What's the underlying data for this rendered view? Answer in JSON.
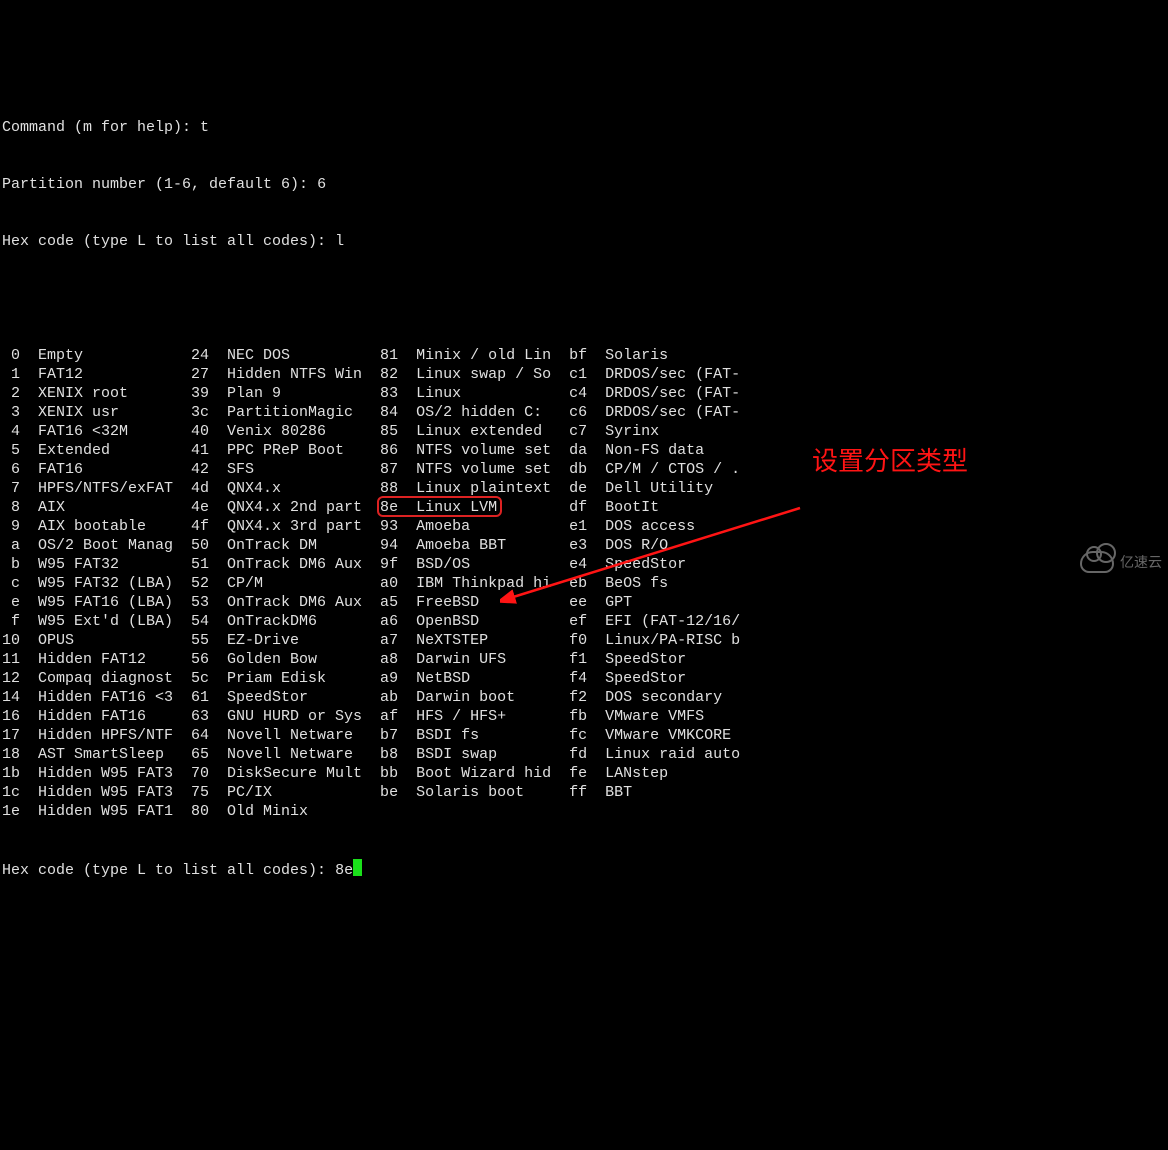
{
  "prompts": {
    "command": "Command (m for help): ",
    "command_input": "t",
    "partition": "Partition number (1-6, default 6): ",
    "partition_input": "6",
    "hexcode1": "Hex code (type L to list all codes): ",
    "hexcode1_input": "l",
    "hexcode2": "Hex code (type L to list all codes): ",
    "hexcode2_input": "8e"
  },
  "table_rows": [
    [
      " 0",
      "Empty",
      "24",
      "NEC DOS",
      "81",
      "Minix / old Lin",
      "bf",
      "Solaris"
    ],
    [
      " 1",
      "FAT12",
      "27",
      "Hidden NTFS Win",
      "82",
      "Linux swap / So",
      "c1",
      "DRDOS/sec (FAT-"
    ],
    [
      " 2",
      "XENIX root",
      "39",
      "Plan 9",
      "83",
      "Linux",
      "c4",
      "DRDOS/sec (FAT-"
    ],
    [
      " 3",
      "XENIX usr",
      "3c",
      "PartitionMagic",
      "84",
      "OS/2 hidden C:",
      "c6",
      "DRDOS/sec (FAT-"
    ],
    [
      " 4",
      "FAT16 <32M",
      "40",
      "Venix 80286",
      "85",
      "Linux extended",
      "c7",
      "Syrinx"
    ],
    [
      " 5",
      "Extended",
      "41",
      "PPC PReP Boot",
      "86",
      "NTFS volume set",
      "da",
      "Non-FS data"
    ],
    [
      " 6",
      "FAT16",
      "42",
      "SFS",
      "87",
      "NTFS volume set",
      "db",
      "CP/M / CTOS / ."
    ],
    [
      " 7",
      "HPFS/NTFS/exFAT",
      "4d",
      "QNX4.x",
      "88",
      "Linux plaintext",
      "de",
      "Dell Utility"
    ],
    [
      " 8",
      "AIX",
      "4e",
      "QNX4.x 2nd part",
      "8e",
      "Linux LVM",
      "df",
      "BootIt"
    ],
    [
      " 9",
      "AIX bootable",
      "4f",
      "QNX4.x 3rd part",
      "93",
      "Amoeba",
      "e1",
      "DOS access"
    ],
    [
      " a",
      "OS/2 Boot Manag",
      "50",
      "OnTrack DM",
      "94",
      "Amoeba BBT",
      "e3",
      "DOS R/O"
    ],
    [
      " b",
      "W95 FAT32",
      "51",
      "OnTrack DM6 Aux",
      "9f",
      "BSD/OS",
      "e4",
      "SpeedStor"
    ],
    [
      " c",
      "W95 FAT32 (LBA)",
      "52",
      "CP/M",
      "a0",
      "IBM Thinkpad hi",
      "eb",
      "BeOS fs"
    ],
    [
      " e",
      "W95 FAT16 (LBA)",
      "53",
      "OnTrack DM6 Aux",
      "a5",
      "FreeBSD",
      "ee",
      "GPT"
    ],
    [
      " f",
      "W95 Ext'd (LBA)",
      "54",
      "OnTrackDM6",
      "a6",
      "OpenBSD",
      "ef",
      "EFI (FAT-12/16/"
    ],
    [
      "10",
      "OPUS",
      "55",
      "EZ-Drive",
      "a7",
      "NeXTSTEP",
      "f0",
      "Linux/PA-RISC b"
    ],
    [
      "11",
      "Hidden FAT12",
      "56",
      "Golden Bow",
      "a8",
      "Darwin UFS",
      "f1",
      "SpeedStor"
    ],
    [
      "12",
      "Compaq diagnost",
      "5c",
      "Priam Edisk",
      "a9",
      "NetBSD",
      "f4",
      "SpeedStor"
    ],
    [
      "14",
      "Hidden FAT16 <3",
      "61",
      "SpeedStor",
      "ab",
      "Darwin boot",
      "f2",
      "DOS secondary"
    ],
    [
      "16",
      "Hidden FAT16",
      "63",
      "GNU HURD or Sys",
      "af",
      "HFS / HFS+",
      "fb",
      "VMware VMFS"
    ],
    [
      "17",
      "Hidden HPFS/NTF",
      "64",
      "Novell Netware",
      "b7",
      "BSDI fs",
      "fc",
      "VMware VMKCORE"
    ],
    [
      "18",
      "AST SmartSleep",
      "65",
      "Novell Netware",
      "b8",
      "BSDI swap",
      "fd",
      "Linux raid auto"
    ],
    [
      "1b",
      "Hidden W95 FAT3",
      "70",
      "DiskSecure Mult",
      "bb",
      "Boot Wizard hid",
      "fe",
      "LANstep"
    ],
    [
      "1c",
      "Hidden W95 FAT3",
      "75",
      "PC/IX",
      "be",
      "Solaris boot",
      "ff",
      "BBT"
    ],
    [
      "1e",
      "Hidden W95 FAT1",
      "80",
      "Old Minix",
      "",
      "",
      "",
      ""
    ]
  ],
  "highlight": {
    "row_index": 8,
    "col_start": 4,
    "label": "Linux LVM"
  },
  "annotation_text": "设置分区类型",
  "watermark_text": "亿速云"
}
